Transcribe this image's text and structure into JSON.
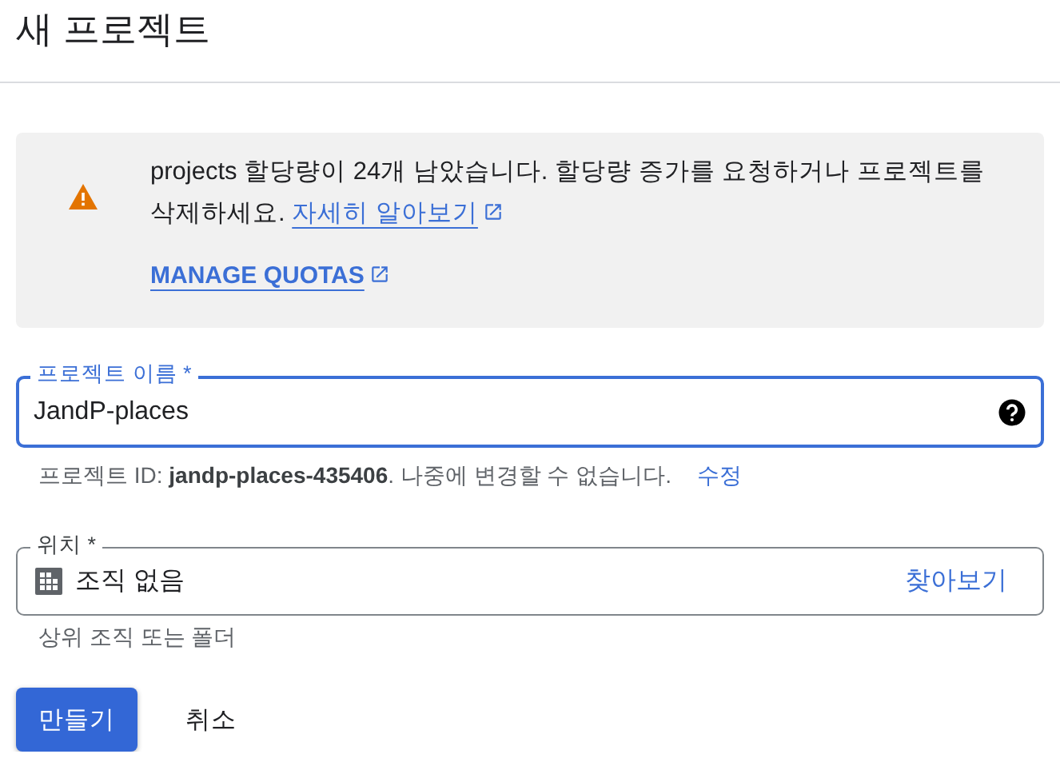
{
  "page": {
    "title": "새 프로젝트"
  },
  "notice": {
    "message": "projects 할당량이 24개 남았습니다. 할당량 증가를 요청하거나 프로젝트를 삭제하세요.",
    "learn_more": "자세히 알아보기",
    "manage": "MANAGE QUOTAS"
  },
  "name_field": {
    "label": "프로젝트 이름 *",
    "value": "JandP-places",
    "focused": true,
    "hint": "프로젝트 ID: **jandp-places-435406**. 나중에 변경할 수 없습니다.",
    "edit": "수정"
  },
  "location_field": {
    "label": "위치 *",
    "value": "조직 없음",
    "browse": "찾아보기",
    "hint": "상위 조직 또는 폴더"
  },
  "buttons": [
    {
      "label": "만들기",
      "kind": "primary"
    },
    {
      "label": "취소",
      "kind": "text"
    }
  ]
}
